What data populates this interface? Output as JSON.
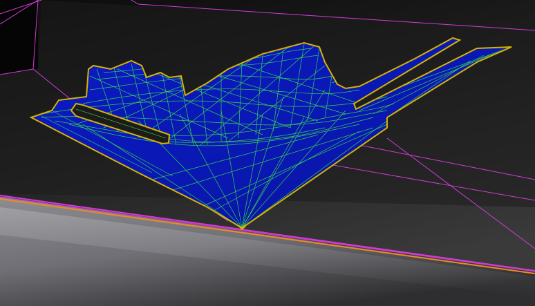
{
  "viewport": {
    "colors": {
      "background_top": "#0d0d0d",
      "background_mid": "#2b2b2b",
      "floor_light": "#9b9aa0",
      "floor_dark": "#3a3a3c",
      "edge_magenta": "#d23bd8",
      "edge_orange": "#f08a1e",
      "surface_fill": "#0a18b8",
      "surface_fill_dark": "#06106e",
      "mesh_green": "#39e84a",
      "boundary_yellow": "#d6b400"
    }
  }
}
